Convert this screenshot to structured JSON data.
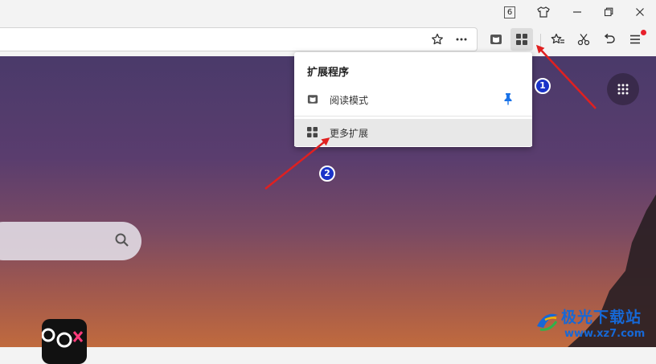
{
  "titlebar": {
    "tab_count": "6",
    "icons": [
      "skin-icon",
      "minimize-icon",
      "restore-icon",
      "close-icon"
    ]
  },
  "toolbar": {
    "address_icons": [
      "star-icon",
      "more-icon"
    ],
    "tools": [
      "reader-icon",
      "extensions-icon",
      "favorites-icon",
      "scissors-icon",
      "undo-icon",
      "menu-icon"
    ],
    "notification_color": "#e8212c"
  },
  "popup": {
    "title": "扩展程序",
    "extension": {
      "label": "阅读模式",
      "pinned": true,
      "pin_color": "#1a73e8"
    },
    "more_label": "更多扩展"
  },
  "annotations": {
    "badges": [
      "1",
      "2"
    ],
    "arrow_color": "#e02020",
    "badge_color": "#1a33c8"
  },
  "watermark": {
    "text": "极光下载站",
    "url": "www.xz7.com"
  }
}
